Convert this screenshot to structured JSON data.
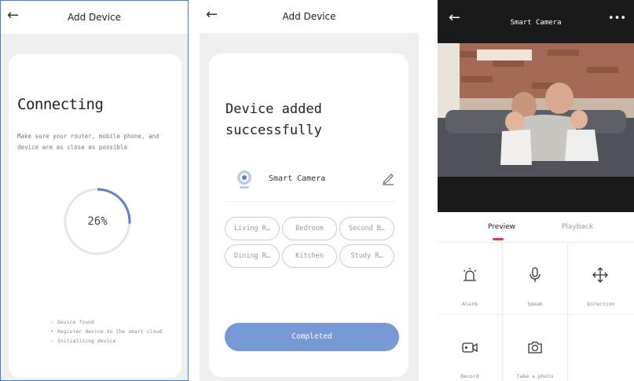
{
  "screen1": {
    "title": "Add Device",
    "heading": "Connecting",
    "subtitle": "Make sure your router, mobile phone, and device are as close as possible",
    "progress_text": "26%",
    "progress": 0.26,
    "steps": [
      {
        "label": "Device found",
        "status": "done"
      },
      {
        "label": "Register device to the smart cloud",
        "status": "pending"
      },
      {
        "label": "Initializing device",
        "status": "done"
      }
    ]
  },
  "screen2": {
    "title": "Add Device",
    "heading_line1": "Device added",
    "heading_line2": "successfully",
    "device_name": "Smart Camera",
    "rooms": [
      "Living R…",
      "Bedroom",
      "Second B…",
      "Dining R…",
      "Kitchen",
      "Study R…"
    ],
    "completed_label": "Completed"
  },
  "screen3": {
    "title": "Smart Camera",
    "tabs": [
      "Preview",
      "Playback"
    ],
    "active_tab": "Preview",
    "actions": [
      {
        "label": "Alarm",
        "icon": "alarm-icon"
      },
      {
        "label": "Speak",
        "icon": "microphone-icon"
      },
      {
        "label": "Direction",
        "icon": "direction-icon"
      },
      {
        "label": "Record",
        "icon": "record-icon"
      },
      {
        "label": "Take a photo",
        "icon": "camera-icon"
      }
    ]
  },
  "colors": {
    "accent": "#7799d5",
    "progress_arc": "#5b83cf",
    "tab_indicator": "#ee3333",
    "check": "#e0b13a"
  }
}
